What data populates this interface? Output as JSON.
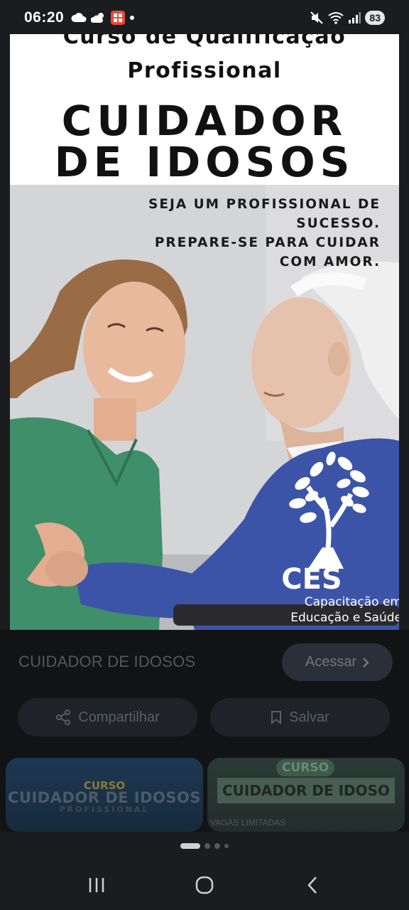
{
  "status_bar": {
    "time": "06:20",
    "battery": "83",
    "icons": [
      "cloud-icon",
      "cloud-sun-icon",
      "app-notification-icon",
      "dot-icon",
      "mute-icon",
      "wifi-icon",
      "signal-icon"
    ]
  },
  "poster": {
    "subtitle_line1": "Curso de Qualificação",
    "subtitle_line2": "Profissional",
    "title_line1": "CUIDADOR",
    "title_line2": "DE IDOSOS",
    "tagline": [
      "SEJA UM PROFISSIONAL DE",
      "SUCESSO.",
      "PREPARE-SE PARA CUIDAR",
      "COM AMOR."
    ],
    "logo_text": "CES",
    "logo_caption_line1": "Capacitação em",
    "logo_caption_line2": "Educação e Saúde"
  },
  "sheet": {
    "title": "CUIDADOR DE IDOSOS",
    "access_label": "Acessar",
    "share_label": "Compartilhar",
    "save_label": "Salvar"
  },
  "related": [
    {
      "small": "CURSO",
      "title": "CUIDADOR DE IDOSOS",
      "subtitle": "PROFISSIONAL"
    },
    {
      "badge": "CURSO",
      "title": "CUIDADOR DE IDOSO",
      "strip": "VAGAS LIMITADAS"
    }
  ],
  "colors": {
    "background": "#1b1c1f",
    "sheet": "#121315",
    "scrub_top": "#3d8fc2",
    "scrub_green": "#3f8f6a",
    "blue_sweater": "#3c54a8"
  }
}
